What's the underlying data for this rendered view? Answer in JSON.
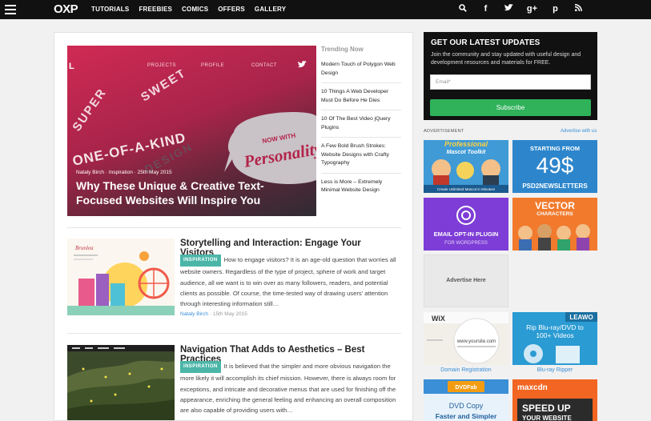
{
  "nav": {
    "logo": "OXP",
    "links": [
      "TUTORIALS",
      "FREEBIES",
      "COMICS",
      "OFFERS",
      "GALLERY"
    ],
    "social_icons": [
      "search-icon",
      "facebook-icon",
      "twitter-icon",
      "google-plus-icon",
      "pinterest-icon",
      "rss-icon"
    ]
  },
  "hero": {
    "brand_letter": "L",
    "nav": [
      "PROJECTS",
      "PROFILE",
      "CONTACT"
    ],
    "art_words": [
      "SUPER",
      "SWEET",
      "ONE-OF-A-KIND",
      "DESIGN",
      "NOW WITH",
      "Personality"
    ],
    "meta": "Nataly Birch · Inspiration · 25th May 2015",
    "title": "Why These Unique & Creative Text-Focused Websites Will Inspire You"
  },
  "trending": {
    "heading": "Trending Now",
    "items": [
      "Modern Touch of Polygon Web Design",
      "10 Things A Web Developer Must Do Before He Dies",
      "10 Of The Best Video jQuery Plugins",
      "A Few Bold Brush Strokes: Website Designs with Crafty Typography",
      "Less is More – Extremely Minimal Website Design"
    ]
  },
  "articles": [
    {
      "title": "Storytelling and Interaction: Engage Your Visitors",
      "badge": "INSPIRATION",
      "excerpt": "How to engage visitors? It is an age-old question that worries all website owners. Regardless of the type of project, sphere of work and target audience, all we want is to win over as many followers, readers, and potential clients as possible. Of course, the time-tested way of drawing users' attention through interesting information still…",
      "author": "Nataly Birch",
      "date": "· 15th May 2015",
      "thumb_brand": "Brunlea"
    },
    {
      "title": "Navigation That Adds to Aesthetics – Best Practices",
      "badge": "INSPIRATION",
      "excerpt": "It is believed that the simpler and more obvious navigation the more likely it will accomplish its chief mission. However, there is always room for exceptions, and intricate and decorative menus that are used for finishing off the appearance, enriching the general feeling and enhancing an overall composition are also capable of providing users with…",
      "author": "",
      "date": ""
    }
  ],
  "newsletter": {
    "heading": "GET OUR LATEST UPDATES",
    "text": "Join the community and stay updated with useful design and development resources and materials for FREE.",
    "email_placeholder": "Email*",
    "button": "Subscribe"
  },
  "ads": {
    "label": "ADVERTISEMENT",
    "advertise_link": "Advertise with us",
    "mascot": {
      "line1": "Professional",
      "line2": "Mascot Toolkit",
      "footer": "Create Unlimited Mascot in Minutes!"
    },
    "psd2": {
      "line1": "STARTING FROM",
      "price": "49$",
      "brand": "PSD2NEWSLETTERS"
    },
    "optin": {
      "line1": "EMAIL OPT-IN PLUGIN",
      "line2": "FOR WORDPRESS"
    },
    "vector": {
      "line1": "VECTOR",
      "line2": "CHARACTERS"
    },
    "placeholder": "Advertise Here",
    "wix": {
      "brand": "WiX",
      "url": "www.yoursite.com",
      "caption": "Domain Registration"
    },
    "leawo": {
      "brand": "LEAWO",
      "line1": "Rip Blu-ray/DVD to",
      "line2": "100+ Videos",
      "caption": "Blu-ray Ripper"
    },
    "dvdfab": {
      "brand": "DVDFab",
      "line1": "DVD Copy",
      "line2": "Faster and Simpler"
    },
    "maxcdn": {
      "brand": "maxcdn",
      "line1": "SPEED UP",
      "line2": "YOUR WEBSITE"
    }
  },
  "colors": {
    "nav_bg": "#111111",
    "hero_pink": "#d02a54",
    "badge_teal": "#4bb6a8",
    "link_blue": "#3a8fd6",
    "subscribe_green": "#2fb25a"
  }
}
